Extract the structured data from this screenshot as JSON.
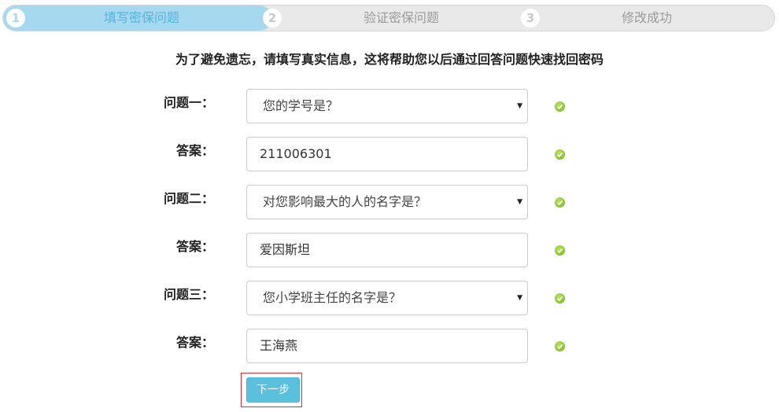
{
  "steps": [
    {
      "number": "1",
      "label": "填写密保问题"
    },
    {
      "number": "2",
      "label": "验证密保问题"
    },
    {
      "number": "3",
      "label": "修改成功"
    }
  ],
  "intro": "为了避免遗忘，请填写真实信息，这将帮助您以后通过回答问题快速找回密码",
  "form": {
    "q1_label": "问题一：",
    "q1_value": "您的学号是？",
    "a1_label": "答案：",
    "a1_value": "211006301",
    "q2_label": "问题二：",
    "q2_value": "对您影响最大的人的名字是？",
    "a2_label": "答案：",
    "a2_value": "爱因斯坦",
    "q3_label": "问题三：",
    "q3_value": "您小学班主任的名字是？",
    "a3_label": "答案：",
    "a3_value": "王海燕",
    "caret": "▼"
  },
  "next_label": "下一步",
  "colors": {
    "active_step": "#a6d9f0",
    "primary_button": "#5bc0de",
    "valid_check": "#6fb51c",
    "highlight_frame": "#d5303a"
  }
}
